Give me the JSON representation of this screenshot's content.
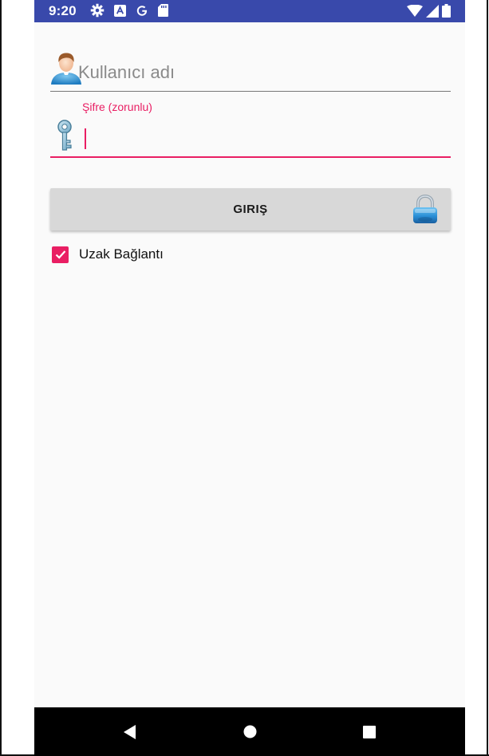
{
  "status_bar": {
    "time": "9:20",
    "background_color": "#3949ab",
    "left_icons": [
      "settings-icon",
      "a-square-icon",
      "google-g-icon",
      "sd-card-icon"
    ],
    "right_icons": [
      "wifi-icon",
      "signal-icon",
      "battery-icon"
    ]
  },
  "login_form": {
    "username": {
      "placeholder": "Kullanıcı adı",
      "value": "",
      "icon": "user-avatar-icon"
    },
    "password": {
      "label": "Şifre (zorunlu)",
      "value": "",
      "icon": "key-icon"
    },
    "login_button": {
      "label": "GIRIŞ",
      "icon": "padlock-icon"
    },
    "remote_connection": {
      "label": "Uzak Bağlantı",
      "checked": true
    },
    "accent_color": "#e91e63"
  },
  "nav_bar": {
    "buttons": [
      "back-icon",
      "home-icon",
      "recents-icon"
    ]
  }
}
